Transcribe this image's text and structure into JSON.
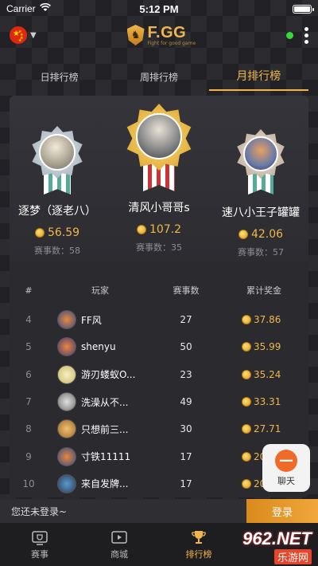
{
  "status_bar": {
    "carrier": "Carrier",
    "time": "5:12 PM"
  },
  "header": {
    "logo_name": "F.GG",
    "logo_tagline": "Fight for good game"
  },
  "tabs": [
    {
      "label": "日排行榜",
      "active": false
    },
    {
      "label": "周排行榜",
      "active": false
    },
    {
      "label": "月排行榜",
      "active": true
    }
  ],
  "podium": [
    {
      "place": 2,
      "name": "逐梦（逐老八）",
      "prize": "56.59",
      "games_label": "赛事数：58"
    },
    {
      "place": 1,
      "name": "清风小哥哥s",
      "prize": "107.2",
      "games_label": "赛事数：35"
    },
    {
      "place": 3,
      "name": "速八小王子罐罐",
      "prize": "42.06",
      "games_label": "赛事数：57"
    }
  ],
  "table": {
    "headers": {
      "rank": "#",
      "player": "玩家",
      "games": "赛事数",
      "prize": "累计奖金"
    },
    "rows": [
      {
        "rank": "4",
        "name": "FF风",
        "games": "27",
        "prize": "37.86"
      },
      {
        "rank": "5",
        "name": "shenyu",
        "games": "50",
        "prize": "35.99"
      },
      {
        "rank": "6",
        "name": "游刃蝼蚁O...",
        "games": "23",
        "prize": "35.24"
      },
      {
        "rank": "7",
        "name": "洗澡从不...",
        "games": "49",
        "prize": "33.31"
      },
      {
        "rank": "8",
        "name": "只想前三...",
        "games": "30",
        "prize": "27.71"
      },
      {
        "rank": "9",
        "name": "寸铁11111",
        "games": "17",
        "prize": "20.74"
      },
      {
        "rank": "10",
        "name": "来自发牌...",
        "games": "17",
        "prize": "20.3"
      }
    ]
  },
  "chat": {
    "label": "聊天"
  },
  "login_bar": {
    "hint": "您还未登录~",
    "button": "登录"
  },
  "bottom_nav": [
    {
      "label": "赛事",
      "icon": "trophy-stand-icon",
      "active": false
    },
    {
      "label": "商城",
      "icon": "video-icon",
      "active": false
    },
    {
      "label": "排行榜",
      "icon": "trophy-icon",
      "active": true
    }
  ],
  "watermark": {
    "number": "962.NET",
    "site": "乐游网"
  },
  "colors": {
    "accent": "#f0b64b",
    "background": "#1b1b1e",
    "panel": "#2a2a2f",
    "online": "#38d838"
  }
}
